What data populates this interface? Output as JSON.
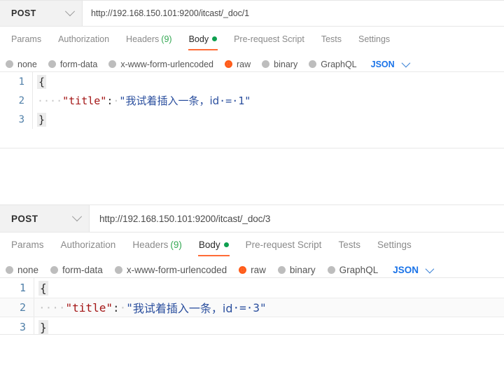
{
  "app": "postman-request-panels",
  "panels": [
    {
      "method": "POST",
      "method_chevron_icon": "chevron-down-icon",
      "url": "http://192.168.150.101:9200/itcast/_doc/1",
      "tabs": [
        {
          "label": "Params",
          "active": false
        },
        {
          "label": "Authorization",
          "active": false
        },
        {
          "label": "Headers",
          "count": "(9)",
          "active": false
        },
        {
          "label": "Body",
          "active": true,
          "dot": true
        },
        {
          "label": "Pre-request Script",
          "active": false
        },
        {
          "label": "Tests",
          "active": false
        },
        {
          "label": "Settings",
          "active": false
        }
      ],
      "body_types": [
        {
          "label": "none",
          "selected": false
        },
        {
          "label": "form-data",
          "selected": false
        },
        {
          "label": "x-www-form-urlencoded",
          "selected": false
        },
        {
          "label": "raw",
          "selected": true
        },
        {
          "label": "binary",
          "selected": false
        },
        {
          "label": "GraphQL",
          "selected": false
        }
      ],
      "format": "JSON",
      "format_chevron_icon": "chevron-down-icon",
      "editor": {
        "lines": [
          {
            "num": "1",
            "open_brace": "{",
            "active": false
          },
          {
            "num": "2",
            "indent": "····",
            "key": "\"title\"",
            "colon": ":",
            "space": "·",
            "value_open": "\"",
            "value_cjk": "我试着插入一条，id",
            "value_tail": "·=·1",
            "value_close": "\"",
            "active": false
          },
          {
            "num": "3",
            "close_brace": "}",
            "active": false
          }
        ]
      }
    },
    {
      "method": "POST",
      "method_chevron_icon": "chevron-down-icon",
      "url": "http://192.168.150.101:9200/itcast/_doc/3",
      "tabs": [
        {
          "label": "Params",
          "active": false
        },
        {
          "label": "Authorization",
          "active": false
        },
        {
          "label": "Headers",
          "count": "(9)",
          "active": false
        },
        {
          "label": "Body",
          "active": true,
          "dot": true
        },
        {
          "label": "Pre-request Script",
          "active": false
        },
        {
          "label": "Tests",
          "active": false
        },
        {
          "label": "Settings",
          "active": false
        }
      ],
      "body_types": [
        {
          "label": "none",
          "selected": false
        },
        {
          "label": "form-data",
          "selected": false
        },
        {
          "label": "x-www-form-urlencoded",
          "selected": false
        },
        {
          "label": "raw",
          "selected": true
        },
        {
          "label": "binary",
          "selected": false
        },
        {
          "label": "GraphQL",
          "selected": false
        }
      ],
      "format": "JSON",
      "format_chevron_icon": "chevron-down-icon",
      "editor": {
        "lines": [
          {
            "num": "1",
            "open_brace": "{",
            "active": false
          },
          {
            "num": "2",
            "indent": "····",
            "key": "\"title\"",
            "colon": ":",
            "space": "·",
            "value_open": "\"",
            "value_cjk": "我试着插入一条，id",
            "value_tail": "·=·3",
            "value_close": "\"",
            "active": true
          },
          {
            "num": "3",
            "close_brace": "}",
            "active": false
          }
        ]
      }
    }
  ],
  "colors": {
    "accent_orange": "#ff6c37",
    "raw_radio": "#ff5c1a",
    "body_dot_green": "#0e9f4f",
    "headers_count_green": "#34a853",
    "json_blue": "#1a73e8",
    "line_number_blue": "#4f7fa8",
    "key_red": "#a31515",
    "string_blue": "#2b4f9e"
  }
}
